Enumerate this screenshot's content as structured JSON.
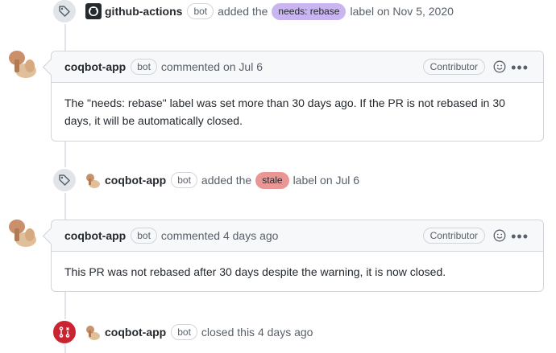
{
  "events": {
    "label1": {
      "actor": "github-actions",
      "bot": "bot",
      "verb": "added the",
      "label": "needs: rebase",
      "tail": "label on Nov 5, 2020"
    },
    "label2": {
      "actor": "coqbot-app",
      "bot": "bot",
      "verb": "added the",
      "label": "stale",
      "tail": "label on Jul 6"
    },
    "closed": {
      "actor": "coqbot-app",
      "bot": "bot",
      "text": "closed this 4 days ago"
    }
  },
  "comments": [
    {
      "author": "coqbot-app",
      "bot": "bot",
      "meta": "commented on Jul 6",
      "role": "Contributor",
      "body_line1": "The \"needs: rebase\" label was set more than 30 days ago. If the PR is not rebased in 30",
      "body_line2": "days, it will be automatically closed."
    },
    {
      "author": "coqbot-app",
      "bot": "bot",
      "meta": "commented 4 days ago",
      "role": "Contributor",
      "body_line1": "This PR was not rebased after 30 days despite the warning, it is now closed."
    }
  ],
  "icons": {
    "label": "tag-icon",
    "closed": "git-pull-request-closed-icon",
    "github": "github-logo-icon",
    "react": "smiley-icon",
    "more": "kebab-horizontal-icon"
  },
  "colors": {
    "label_rebase": "#c9b6f0",
    "label_stale": "#e99695",
    "closed_red": "#cb2431"
  }
}
